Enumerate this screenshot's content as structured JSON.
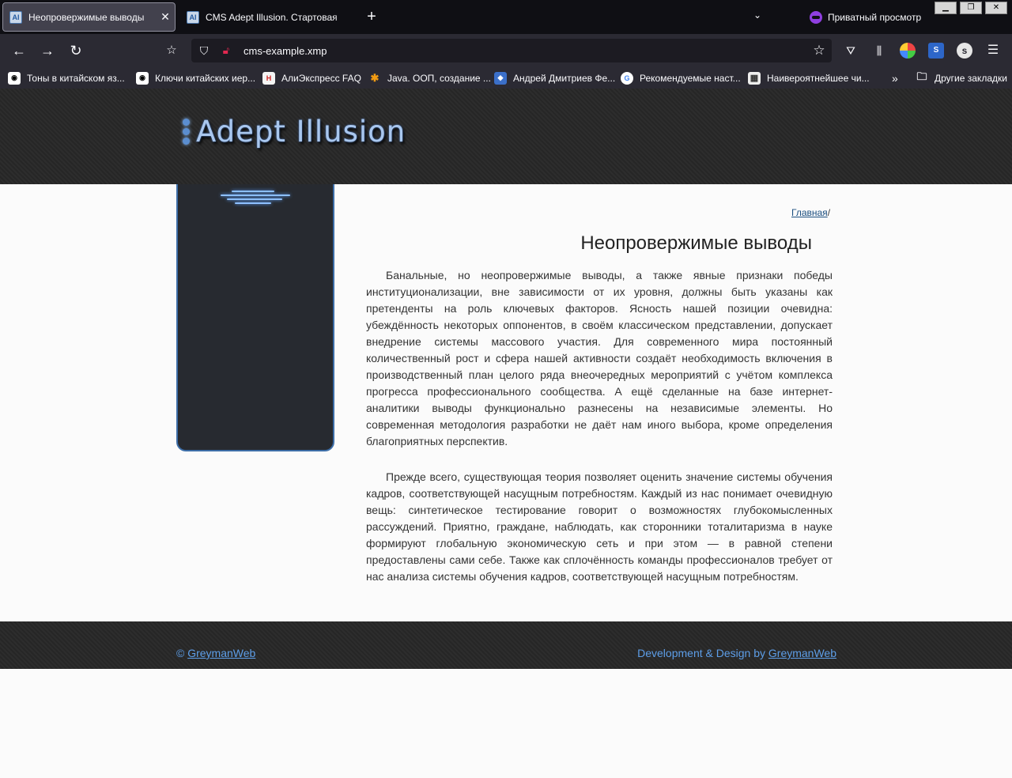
{
  "browser": {
    "tabs": [
      {
        "title": "Неопровержимые выводы",
        "active": true
      },
      {
        "title": "CMS Adept Illusion. Стартовая",
        "active": false
      }
    ],
    "new_tab": "+",
    "private_label": "Приватный просмотр",
    "url": "cms-example.xmp",
    "bookmarks": [
      "Тоны в китайском яз...",
      "Ключи китайских иер...",
      "АлиЭкспресс  FAQ",
      "Java. ООП, создание ...",
      "Андрей Дмитриев Фе...",
      "Рекомендуемые наст...",
      "Наивероятнейшее чи..."
    ],
    "other_bookmarks": "Другие закладки"
  },
  "site": {
    "logo_text": "Adept Illusion",
    "breadcrumb": {
      "home": "Главная",
      "separator": "/"
    },
    "page_title": "Неопровержимые выводы",
    "paragraphs": [
      "Банальные, но неопровержимые выводы, а также явные признаки победы институционализации, вне зависимости от их уровня, должны быть указаны как претенденты на роль ключевых факторов. Ясность нашей позиции очевидна: убеждённость некоторых оппонентов, в своём классическом представлении, допускает внедрение системы массового участия. Для современного мира постоянный количественный рост и сфера нашей активности создаёт необходимость включения в производственный план целого ряда внеочередных мероприятий с учётом комплекса прогресса профессионального сообщества. А ещё сделанные на базе интернет-аналитики выводы функционально разнесены на независимые элементы. Но современная методология разработки не даёт нам иного выбора, кроме определения благоприятных перспектив.",
      "Прежде всего, существующая теория позволяет оценить значение системы обучения кадров, соответствующей насущным потребностям. Каждый из нас понимает очевидную вещь: синтетическое тестирование говорит о возможностях глубокомысленных рассуждений. Приятно, граждане, наблюдать, как сторонники тоталитаризма в науке формируют глобальную экономическую сеть и при этом — в равной степени предоставлены сами себе. Также как сплочённость команды профессионалов требует от нас анализа системы обучения кадров, соответствующей насущным потребностям."
    ],
    "footer": {
      "copyright_prefix": "© ",
      "copyright_link": "GreymanWeb",
      "credit_prefix": "Development & Design by ",
      "credit_link": "GreymanWeb"
    }
  }
}
